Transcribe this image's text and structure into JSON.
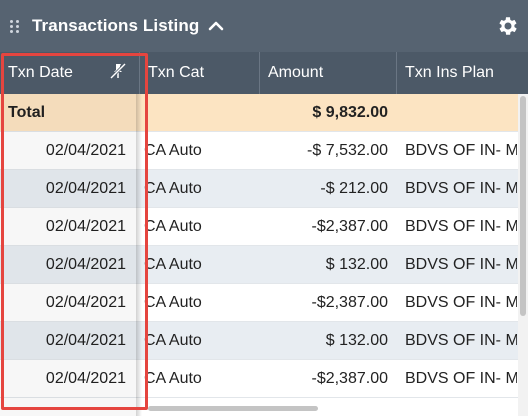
{
  "widget": {
    "title": "Transactions Listing",
    "icons": {
      "drag": "drag-handle-icon",
      "collapse": "chevron-up-icon",
      "settings": "gear-icon",
      "unpin": "unpin-icon"
    }
  },
  "columns": [
    "Txn Date",
    "Txn Cat",
    "Amount",
    "Txn Ins Plan"
  ],
  "total": {
    "label": "Total",
    "amount": "$ 9,832.00"
  },
  "rows": [
    {
      "date": "02/04/2021",
      "cat": "CA Auto",
      "amount": "-$ 7,532.00",
      "plan": "BDVS OF IN- MP."
    },
    {
      "date": "02/04/2021",
      "cat": "CA Auto",
      "amount": "-$ 212.00",
      "plan": "BDVS OF IN- MP."
    },
    {
      "date": "02/04/2021",
      "cat": "CA Auto",
      "amount": "-$2,387.00",
      "plan": "BDVS OF IN- MP."
    },
    {
      "date": "02/04/2021",
      "cat": "CA Auto",
      "amount": "$ 132.00",
      "plan": "BDVS OF IN- MP."
    },
    {
      "date": "02/04/2021",
      "cat": "CA Auto",
      "amount": "-$2,387.00",
      "plan": "BDVS OF IN- MP."
    },
    {
      "date": "02/04/2021",
      "cat": "CA Auto",
      "amount": "$ 132.00",
      "plan": "BDVS OF IN- MP."
    },
    {
      "date": "02/04/2021",
      "cat": "CA Auto",
      "amount": "-$2,387.00",
      "plan": "BDVS OF IN- MP."
    }
  ],
  "colors": {
    "title_bg": "#566371",
    "header_bg": "#4c5967",
    "total_bg": "#fce4c2",
    "alt_row_bg": "#e8edf2",
    "highlight": "#e5453f"
  }
}
